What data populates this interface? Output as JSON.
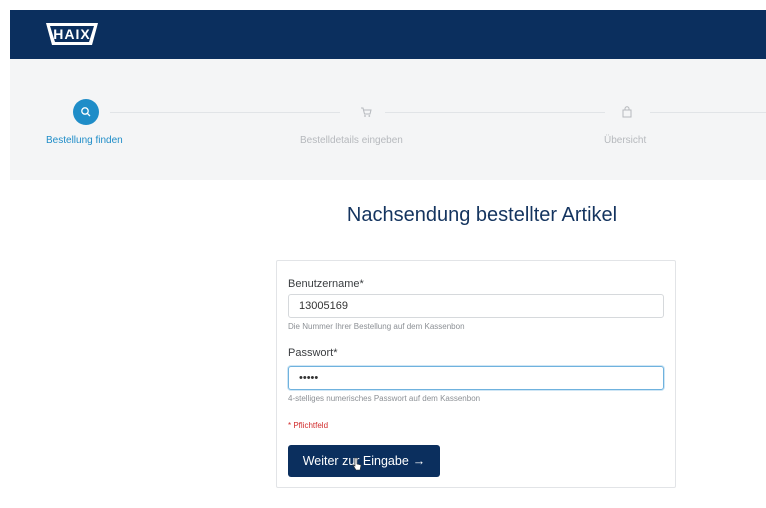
{
  "brand": {
    "logo_text": "HAIX",
    "header_color": "#0b2f5e"
  },
  "stepper": {
    "steps": [
      {
        "label": "Bestellung finden",
        "icon": "search-icon",
        "state": "active"
      },
      {
        "label": "Bestelldetails eingeben",
        "icon": "cart-icon",
        "state": "inactive"
      },
      {
        "label": "Übersicht",
        "icon": "bag-icon",
        "state": "inactive"
      }
    ],
    "active_color": "#1f8dc8"
  },
  "main": {
    "title": "Nachsendung bestellter Artikel"
  },
  "form": {
    "username": {
      "label": "Benutzername*",
      "value": "13005169",
      "hint": "Die Nummer Ihrer Bestellung auf dem Kassenbon"
    },
    "password": {
      "label": "Passwort*",
      "value": "•••••",
      "hint": "4-stelliges numerisches Passwort auf dem Kassenbon"
    },
    "required_note": "* Pflichtfeld",
    "submit": {
      "label": "Weiter zur Eingabe",
      "icon": "arrow-right-icon"
    }
  }
}
